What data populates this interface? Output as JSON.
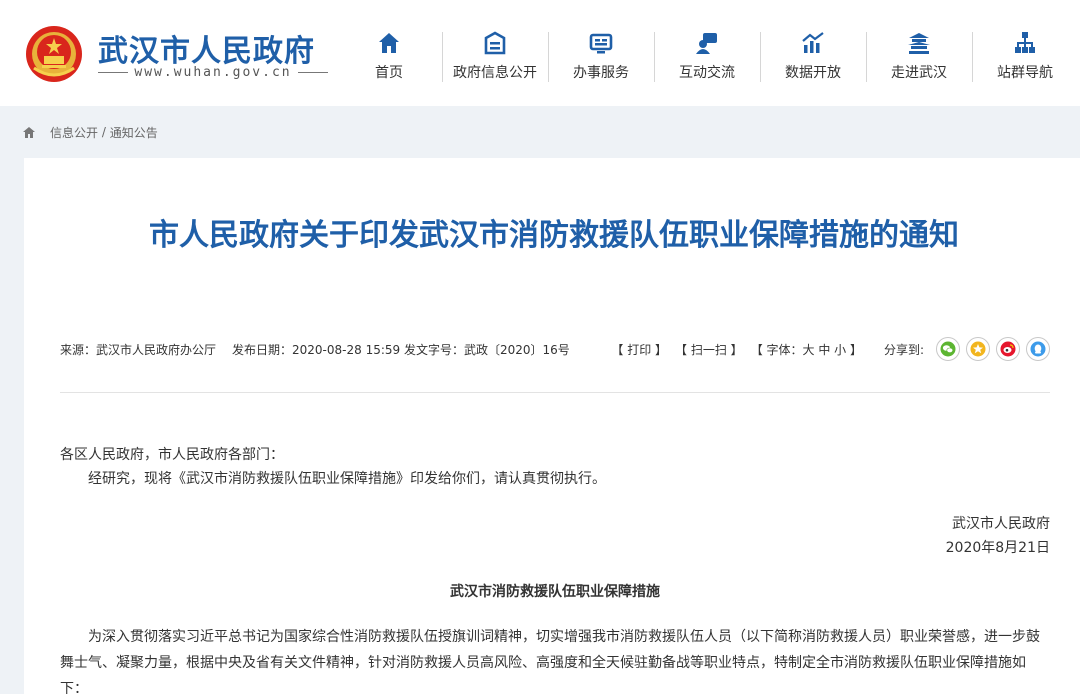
{
  "header": {
    "site_name": "武汉市人民政府",
    "site_url": "www.wuhan.gov.cn",
    "nav": [
      {
        "label": "首页",
        "icon": "home-icon"
      },
      {
        "label": "政府信息公开",
        "icon": "info-disclosure-icon"
      },
      {
        "label": "办事服务",
        "icon": "service-icon"
      },
      {
        "label": "互动交流",
        "icon": "interaction-icon"
      },
      {
        "label": "数据开放",
        "icon": "data-chart-icon"
      },
      {
        "label": "走进武汉",
        "icon": "landmark-icon"
      },
      {
        "label": "站群导航",
        "icon": "sitemap-icon"
      }
    ]
  },
  "breadcrumb": {
    "item1": "信息公开",
    "separator": "/",
    "item2": "通知公告"
  },
  "article": {
    "title": "市人民政府关于印发武汉市消防救援队伍职业保障措施的通知",
    "source": "来源：武汉市人民政府办公厅",
    "publish": "发布日期：2020-08-28 15:59 发文字号：武政〔2020〕16号",
    "tools": {
      "print": "【 打印 】",
      "scan": "【 扫一扫 】",
      "font": "【 字体：大 中 小 】",
      "share_label": "分享到:"
    },
    "share": [
      {
        "name": "wechat",
        "color": "#5cb531"
      },
      {
        "name": "favorite",
        "color": "#f2b51e"
      },
      {
        "name": "weibo",
        "color": "#e6162d"
      },
      {
        "name": "qq",
        "color": "#3d9bea"
      }
    ],
    "salutation": "各区人民政府，市人民政府各部门：",
    "para1": "经研究，现将《武汉市消防救援队伍职业保障措施》印发给你们，请认真贯彻执行。",
    "signer": "武汉市人民政府",
    "date": "2020年8月21日",
    "sub_title": "武汉市消防救援队伍职业保障措施",
    "para2": "为深入贯彻落实习近平总书记为国家综合性消防救援队伍授旗训词精神，切实增强我市消防救援队伍人员（以下简称消防救援人员）职业荣誉感，进一步鼓舞士气、凝聚力量，根据中央及省有关文件精神，针对消防救援人员高风险、高强度和全天候驻勤备战等职业特点，特制定全市消防救援队伍职业保障措施如下："
  },
  "colors": {
    "brand_blue": "#1f5fa8",
    "page_bg": "#eef2f6"
  }
}
